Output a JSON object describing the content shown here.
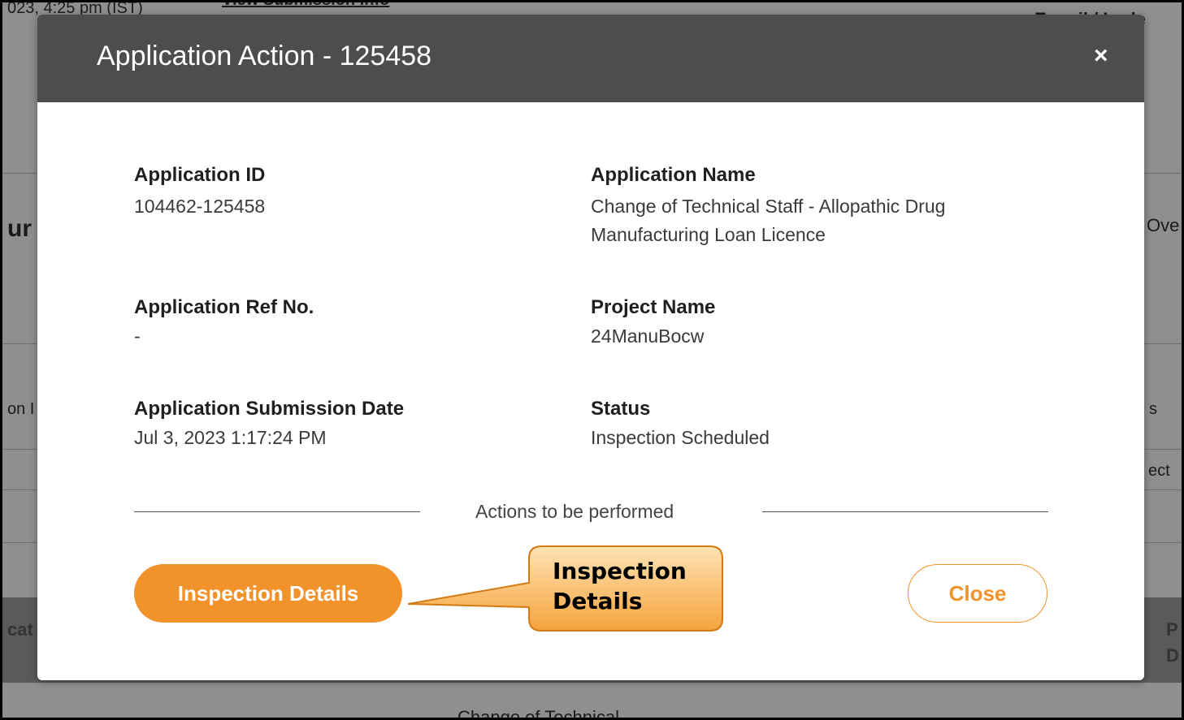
{
  "background": {
    "top_left": "023, 4:25 pm (IST)",
    "top_mid": "View Submission Info",
    "top_right": "E-mail / Lode",
    "left_heading": "ur",
    "right_button": "Ove",
    "left_col": "on I",
    "right_col": "s",
    "right_select": "ect",
    "left_band": "cat",
    "right_band_1": "P",
    "right_band_2": "D",
    "bottom_text": "Change of Technical"
  },
  "modal": {
    "title": "Application Action - 125458",
    "close_icon": "×",
    "fields": {
      "application_id": {
        "label": "Application ID",
        "value": "104462-125458"
      },
      "application_name": {
        "label": "Application Name",
        "value": "Change of Technical Staff - Allopathic Drug Manufacturing Loan Licence"
      },
      "ref_no": {
        "label": "Application Ref No.",
        "value": "-"
      },
      "project_name": {
        "label": "Project Name",
        "value": "24ManuBocw"
      },
      "submission_date": {
        "label": "Application Submission Date",
        "value": "Jul 3, 2023 1:17:24 PM"
      },
      "status": {
        "label": "Status",
        "value": "Inspection Scheduled"
      }
    },
    "actions_heading": "Actions to be performed",
    "inspection_button": "Inspection Details",
    "close_button": "Close"
  },
  "callout": {
    "text": "Inspection\nDetails"
  },
  "colors": {
    "accent": "#f2922a",
    "header": "#4d4d4d",
    "overlay": "#8f8f8f"
  }
}
